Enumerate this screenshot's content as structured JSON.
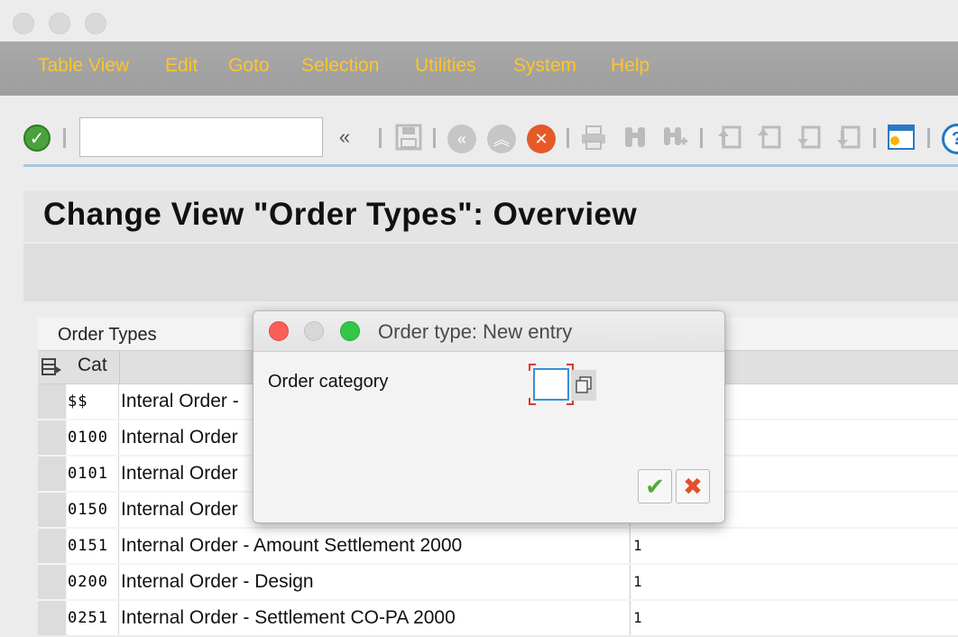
{
  "menu": {
    "items": [
      "Table View",
      "Edit",
      "Goto",
      "Selection",
      "Utilities",
      "System",
      "Help"
    ]
  },
  "toolbar": {
    "command_value": "",
    "expand_label": "«",
    "icons": [
      "enter-icon",
      "save-icon",
      "back-icon",
      "exit-icon",
      "cancel-icon",
      "print-icon",
      "find-icon",
      "find-next-icon",
      "first-page-icon",
      "previous-page-icon",
      "next-page-icon",
      "last-page-icon",
      "create-session-icon",
      "help-icon"
    ]
  },
  "page": {
    "title": "Change View \"Order Types\": Overview"
  },
  "table": {
    "caption": "Order Types",
    "header_cat": "Cat",
    "rows": [
      {
        "code": "$$",
        "text": "Interal Order -",
        "num": ""
      },
      {
        "code": "0100",
        "text": "Internal Order",
        "num": ""
      },
      {
        "code": "0101",
        "text": "Internal Order",
        "num": ""
      },
      {
        "code": "0150",
        "text": "Internal Order",
        "num": ""
      },
      {
        "code": "0151",
        "text": "Internal Order - Amount Settlement  2000",
        "num": "1"
      },
      {
        "code": "0200",
        "text": "Internal Order - Design",
        "num": "1"
      },
      {
        "code": "0251",
        "text": "Internal Order - Settlement CO-PA   2000",
        "num": "1"
      }
    ]
  },
  "dialog": {
    "title": "Order type: New entry",
    "field_label": "Order category",
    "field_value": "",
    "colors": {
      "close": "#fc5f57",
      "minimize": "#d7d7d7",
      "zoom": "#33c748",
      "confirm": "#5aa63c",
      "cancel": "#e0502a"
    }
  }
}
